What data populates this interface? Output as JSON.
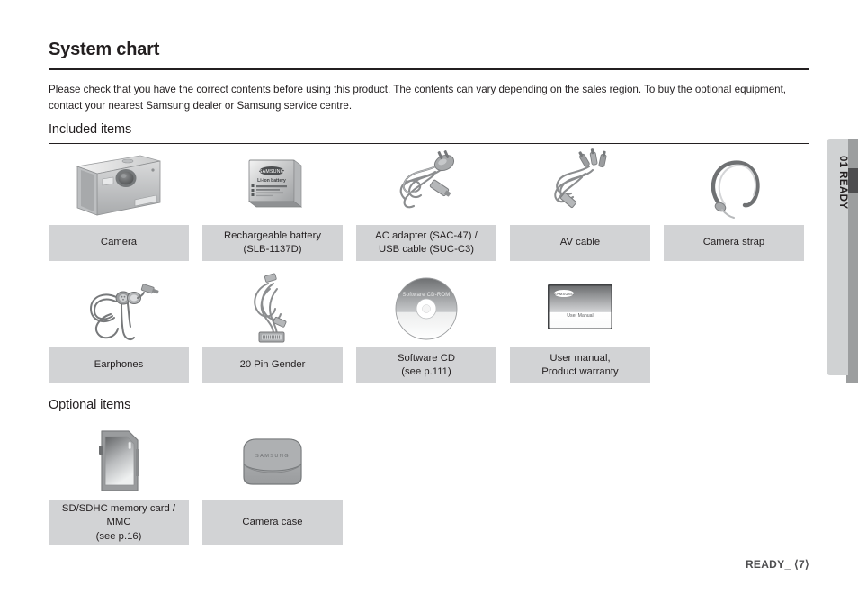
{
  "page": {
    "title": "System chart",
    "intro": "Please check that you have the correct contents before using this product. The contents can vary depending on the sales region. To buy the optional equipment, contact your nearest Samsung dealer or Samsung service centre.",
    "side_tab_label": "01 READY",
    "footer": "READY_ ⟨7⟩"
  },
  "sections": {
    "included": {
      "heading": "Included items",
      "row1": [
        {
          "icon": "camera-icon",
          "label": "Camera"
        },
        {
          "icon": "battery-icon",
          "label": "Rechargeable battery\n(SLB-1137D)",
          "line1": "Rechargeable battery",
          "line2": "(SLB-1137D)"
        },
        {
          "icon": "ac-adapter-usb-cable-icon",
          "label": "AC adapter (SAC-47) /\nUSB cable (SUC-C3)",
          "line1": "AC adapter (SAC-47) /",
          "line2": "USB cable (SUC-C3)"
        },
        {
          "icon": "av-cable-icon",
          "label": "AV cable"
        },
        {
          "icon": "camera-strap-icon",
          "label": "Camera strap"
        }
      ],
      "row2": [
        {
          "icon": "earphones-icon",
          "label": "Earphones"
        },
        {
          "icon": "pin-gender-cable-icon",
          "label": "20 Pin Gender"
        },
        {
          "icon": "software-cd-icon",
          "label": "Software CD\n(see p.111)",
          "line1": "Software CD",
          "line2": "(see p.111)",
          "disc_text": "Software CD-ROM"
        },
        {
          "icon": "user-manual-icon",
          "label": "User manual,\nProduct warranty",
          "line1": "User manual,",
          "line2": "Product warranty",
          "cover_brand": "SAMSUNG",
          "cover_text": "User Manual"
        }
      ]
    },
    "optional": {
      "heading": "Optional items",
      "row1": [
        {
          "icon": "memory-card-icon",
          "label": "SD/SDHC memory card /\nMMC\n(see p.16)",
          "line1": "SD/SDHC memory card /",
          "line2": "MMC",
          "line3": "(see p.16)"
        },
        {
          "icon": "camera-case-icon",
          "label": "Camera case",
          "brand": "SAMSUNG"
        }
      ]
    }
  },
  "colors": {
    "caption_bg": "#d2d3d5",
    "text": "#231f20",
    "tab_bg": "#d0d2d3",
    "tab_accent": "#9c9e9f",
    "tab_block": "#4d4d4f",
    "footer_text": "#4d4d4f"
  }
}
